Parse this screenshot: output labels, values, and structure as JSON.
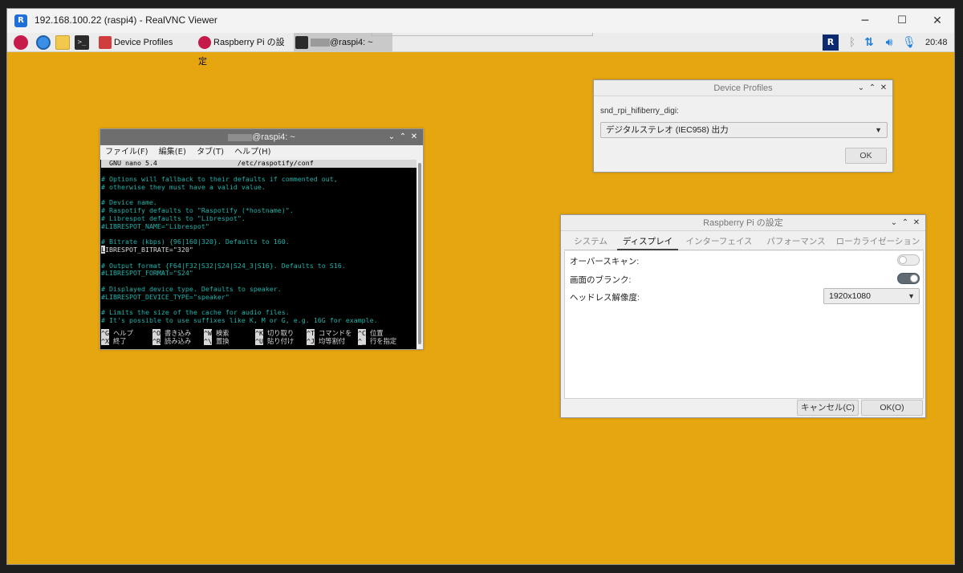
{
  "vnc": {
    "title": "192.168.100.22 (raspi4) - RealVNC Viewer",
    "app_icon_text": "R",
    "controls": {
      "minimize": "─",
      "maximize": "☐",
      "close": "✕"
    }
  },
  "panel": {
    "launchers": [
      "raspberry-menu-icon",
      "web-browser-icon",
      "file-manager-icon",
      "terminal-icon"
    ],
    "tasks": [
      {
        "label": "Device Profiles",
        "icon": "mixer-icon"
      },
      {
        "label": "Raspberry Pi の設定",
        "icon": "raspberry-icon"
      },
      {
        "label": "@raspi4: ~",
        "icon": "terminal-icon"
      }
    ],
    "clock": "20:48",
    "tray_icons": [
      "vnc-icon",
      "bluetooth-icon",
      "network-icon",
      "volume-icon",
      "microphone-icon"
    ]
  },
  "terminal": {
    "title": "@raspi4: ~",
    "menu": [
      "ファイル(F)",
      "編集(E)",
      "タブ(T)",
      "ヘルプ(H)"
    ],
    "nano_header": "  GNU nano 5.4                    /etc/raspotify/conf",
    "lines": [
      {
        "text": "",
        "white": false
      },
      {
        "text": "# Options will fallback to their defaults if commented out,",
        "white": false
      },
      {
        "text": "# otherwise they must have a valid value.",
        "white": false
      },
      {
        "text": "",
        "white": false
      },
      {
        "text": "# Device name.",
        "white": false
      },
      {
        "text": "# Raspotify defaults to \"Raspotify (*hostname)\".",
        "white": false
      },
      {
        "text": "# Librespot defaults to \"Librespot\".",
        "white": false
      },
      {
        "text": "#LIBRESPOT_NAME=\"Librespot\"",
        "white": false
      },
      {
        "text": "",
        "white": false
      },
      {
        "text": "# Bitrate (kbps) {96|160|320}. Defaults to 160.",
        "white": false
      },
      {
        "text": "IBRESPOT_BITRATE=\"320\"",
        "white": true,
        "cursor": "L"
      },
      {
        "text": "",
        "white": false
      },
      {
        "text": "# Output format {F64|F32|S32|S24|S24_3|S16}. Defaults to S16.",
        "white": false
      },
      {
        "text": "#LIBRESPOT_FORMAT=\"S24\"",
        "white": false
      },
      {
        "text": "",
        "white": false
      },
      {
        "text": "# Displayed device type. Defaults to speaker.",
        "white": false
      },
      {
        "text": "#LIBRESPOT_DEVICE_TYPE=\"speaker\"",
        "white": false
      },
      {
        "text": "",
        "white": false
      },
      {
        "text": "# Limits the size of the cache for audio files.",
        "white": false
      },
      {
        "text": "# It's possible to use suffixes like K, M or G, e.g. 16G for example.",
        "white": false
      }
    ],
    "shortcuts_row1": [
      {
        "key": "^G",
        "label": " ヘルプ"
      },
      {
        "key": "^O",
        "label": " 書き込み"
      },
      {
        "key": "^W",
        "label": " 検索"
      },
      {
        "key": "^K",
        "label": " 切り取り"
      },
      {
        "key": "^T",
        "label": " コマンドを"
      },
      {
        "key": "^C",
        "label": " 位置"
      }
    ],
    "shortcuts_row2": [
      {
        "key": "^X",
        "label": " 終了"
      },
      {
        "key": "^R",
        "label": " 読み込み"
      },
      {
        "key": "^\\",
        "label": " 置換"
      },
      {
        "key": "^U",
        "label": " 貼り付け"
      },
      {
        "key": "^J",
        "label": " 均等割付"
      },
      {
        "key": "^_",
        "label": " 行を指定"
      }
    ]
  },
  "device_profiles": {
    "title": "Device Profiles",
    "label": "snd_rpi_hifiberry_digi:",
    "selected": "デジタルステレオ (IEC958) 出力",
    "ok": "OK"
  },
  "rpi_config": {
    "title": "Raspberry Pi の設定",
    "tabs": [
      "システム",
      "ディスプレイ",
      "インターフェイス",
      "パフォーマンス",
      "ローカライゼーション"
    ],
    "active_tab": "ディスプレイ",
    "overscan_label": "オーバースキャン:",
    "overscan_on": false,
    "blanking_label": "画面のブランク:",
    "blanking_on": true,
    "headless_label": "ヘッドレス解像度:",
    "headless_value": "1920x1080",
    "cancel": "キャンセル(C)",
    "ok": "OK(O)"
  },
  "colors": {
    "desktop": "#e6a60f",
    "terminal_text": "#20b2aa"
  }
}
